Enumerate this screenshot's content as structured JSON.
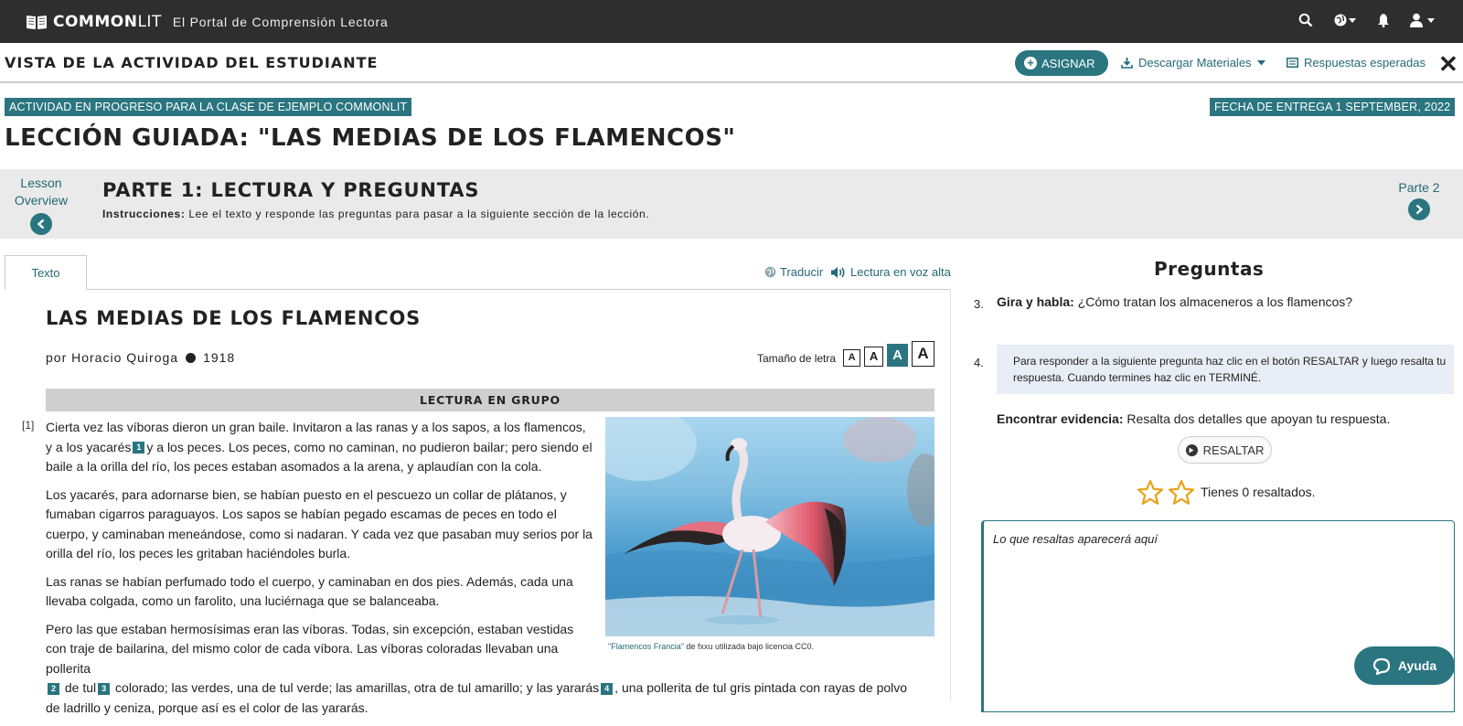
{
  "topnav": {
    "brand_bold": "COMMON",
    "brand_light": "LIT",
    "tagline": "El Portal de Comprensión Lectora"
  },
  "viewbar": {
    "title": "VISTA DE LA ACTIVIDAD DEL ESTUDIANTE",
    "assign_label": "ASIGNAR",
    "download_label": "Descargar Materiales",
    "answers_label": "Respuestas esperadas"
  },
  "status": {
    "activity": "ACTIVIDAD EN PROGRESO PARA LA CLASE DE EJEMPLO COMMONLIT",
    "due": "FECHA DE ENTREGA 1 SEPTEMBER, 2022"
  },
  "lesson": {
    "title": "LECCIÓN GUIADA: \"LAS MEDIAS DE LOS FLAMENCOS\""
  },
  "part": {
    "overview_line1": "Lesson",
    "overview_line2": "Overview",
    "title": "PARTE 1: LECTURA Y PREGUNTAS",
    "instr_label": "Instrucciones:",
    "instr_text": "Lee el texto y responde las preguntas para pasar a la siguiente sección de la lección.",
    "next_label": "Parte 2"
  },
  "text_panel": {
    "tab_label": "Texto",
    "translate_label": "Traducir",
    "read_aloud_label": "Lectura en voz alta",
    "story_title": "LAS MEDIAS DE LOS FLAMENCOS",
    "author": "por Horacio Quiroga",
    "year": "1918",
    "font_size_label": "Tamaño de letra",
    "font_size_options": [
      "A",
      "A",
      "A",
      "A"
    ],
    "group_label": "LECTURA EN GRUPO",
    "para_num": "[1]",
    "p1_a": "Cierta vez las víboras dieron un gran baile. Invitaron a las ranas y a los sapos, a los flamencos, y a los yacarés",
    "p1_b": "y a los peces. Los peces, como no caminan, no pudieron bailar; pero siendo el baile a la orilla del río, los peces estaban asomados a la arena, y aplaudían con la cola.",
    "p2": "Los yacarés, para adornarse bien, se habían puesto en el pescuezo un collar de plátanos, y fumaban cigarros paraguayos. Los sapos se habían pegado escamas de peces en todo el cuerpo, y caminaban meneándose, como si nadaran. Y cada vez que pasaban muy serios por la orilla del río, los peces les gritaban haciéndoles burla.",
    "p3": "Las ranas se habían perfumado todo el cuerpo, y caminaban en dos pies. Además, cada una llevaba colgada, como un farolito, una luciérnaga que se balanceaba.",
    "p4_a": "Pero las que estaban hermosísimas eran las víboras. Todas, sin excepción, estaban vestidas con traje de bailarina, del mismo color de cada víbora. Las víboras coloradas llevaban una pollerita",
    "p4_b": "de tul",
    "p4_c": "colorado; las verdes, una de tul verde; las amarillas, otra de tul amarillo; y las yararás",
    "p4_d": ", una pollerita de tul gris pintada con rayas de polvo de ladrillo y ceniza, porque así es el color de las yararás.",
    "footnotes": [
      "1",
      "2",
      "3",
      "4"
    ],
    "caption_link": "\"Flamencos Francia\"",
    "caption_rest": " de fxxu utilizada bajo licencia CC0."
  },
  "questions": {
    "title": "Preguntas",
    "q3_num": "3.",
    "q3_label": "Gira y habla:",
    "q3_text": "¿Cómo tratan los almaceneros a los flamencos?",
    "q4_num": "4.",
    "q4_instr": "Para responder a la siguiente pregunta haz clic en el botón RESALTAR y luego resalta tu respuesta. Cuando termines haz clic en TERMINÉ.",
    "evid_label": "Encontrar evidencia:",
    "evid_text": "Resalta dos detalles que apoyan tu respuesta.",
    "highlight_btn": "RESALTAR",
    "highlight_count": "Tienes 0 resaltados.",
    "highlight_placeholder": "Lo que resaltas aparecerá aquí",
    "help_label": "Ayuda"
  },
  "colors": {
    "accent": "#2a7580",
    "nav": "#2e2e2e",
    "star": "#e8a317"
  }
}
